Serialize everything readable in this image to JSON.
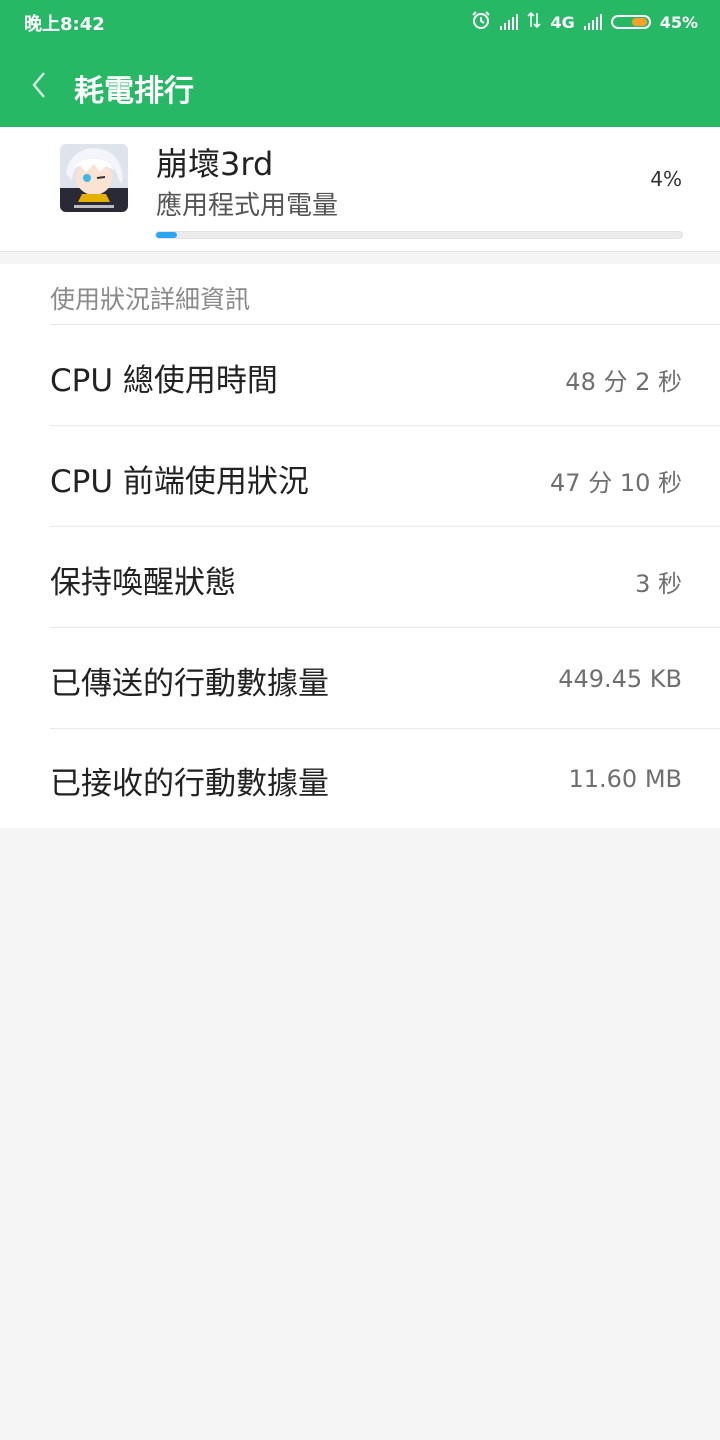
{
  "status_bar": {
    "time": "晚上8:42",
    "network": "4G",
    "battery": "45%",
    "battery_level": 0.45,
    "icons": [
      "alarm-icon",
      "signal-icon",
      "data-arrows-icon",
      "signal-icon",
      "battery-icon"
    ]
  },
  "app_bar": {
    "title": "耗電排行",
    "back_icon": "chevron-left-icon"
  },
  "app": {
    "name": "崩壞3rd",
    "subtitle": "應用程式用電量",
    "percent": "4%",
    "percent_value": 0.04
  },
  "details": {
    "section_title": "使用狀況詳細資訊",
    "rows": [
      {
        "label": "CPU 總使用時間",
        "value": "48 分 2 秒"
      },
      {
        "label": "CPU 前端使用狀況",
        "value": "47 分 10 秒"
      },
      {
        "label": "保持喚醒狀態",
        "value": "3 秒"
      },
      {
        "label": "已傳送的行動數據量",
        "value": "449.45 KB"
      },
      {
        "label": "已接收的行動數據量",
        "value": "11.60 MB"
      }
    ]
  },
  "colors": {
    "accent": "#27b865",
    "progress": "#2aa5f2",
    "battery_fill": "#f6a22a"
  }
}
